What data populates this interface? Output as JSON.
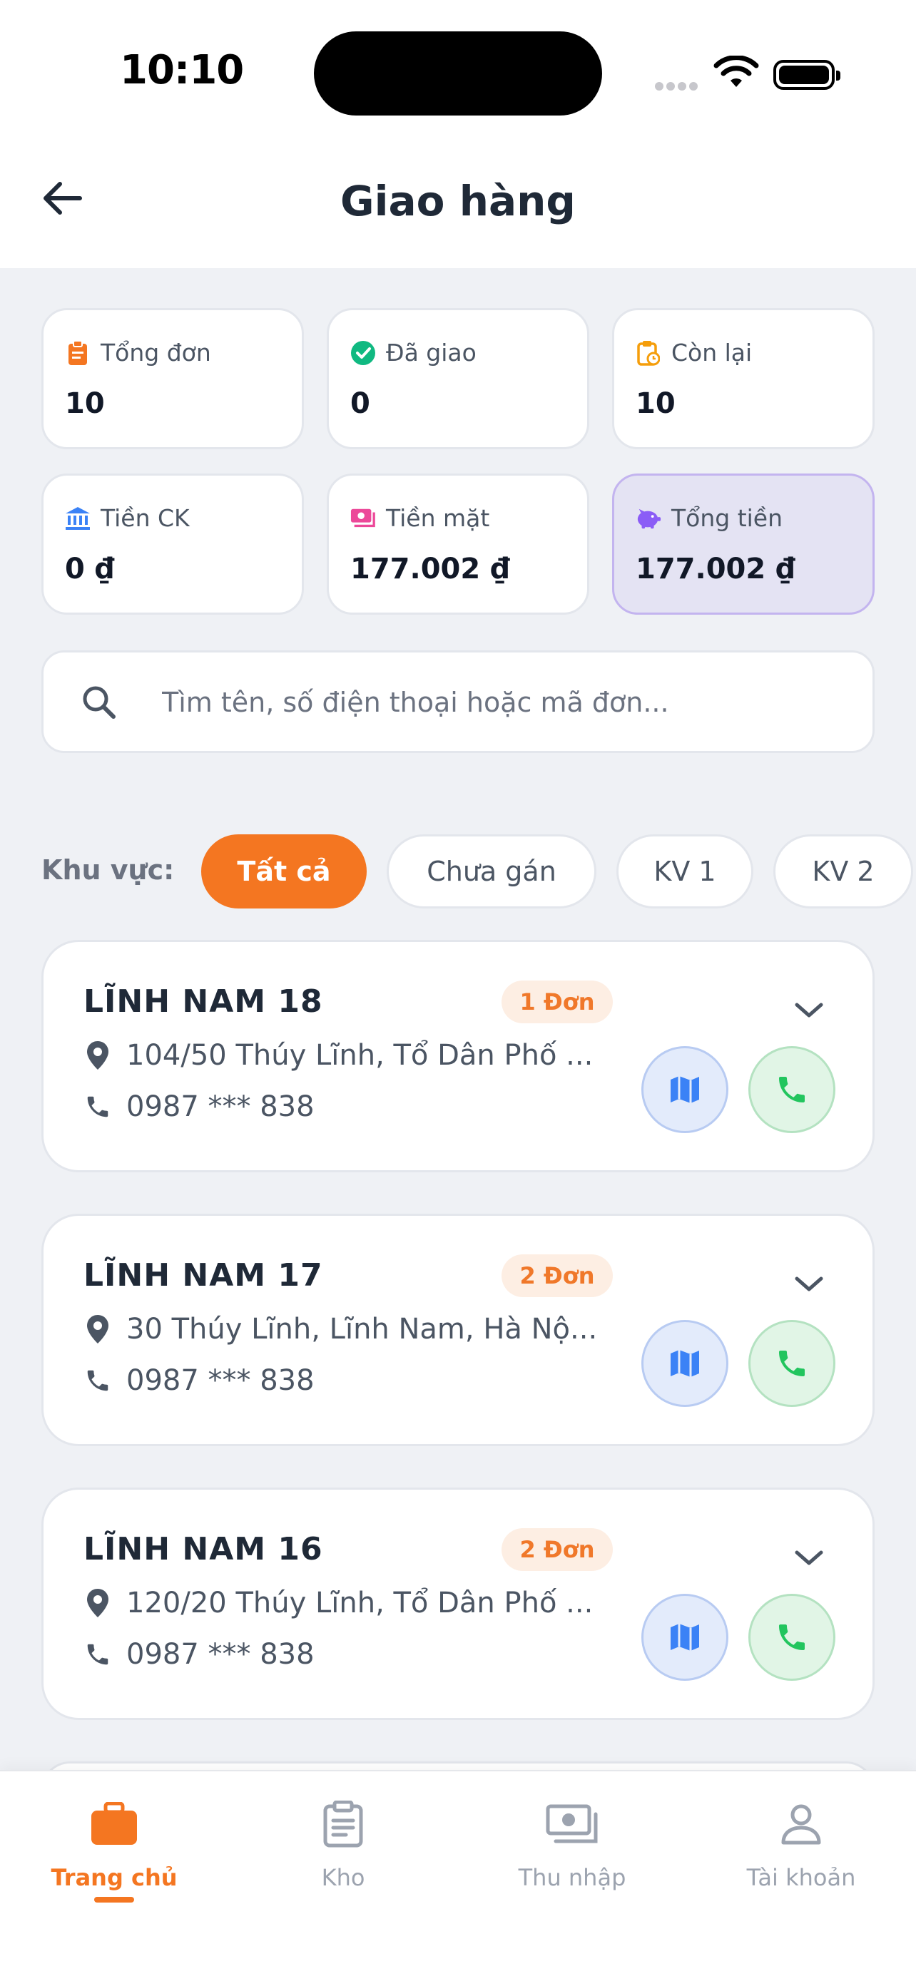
{
  "status_bar": {
    "time": "10:10"
  },
  "header": {
    "title": "Giao hàng"
  },
  "stats": [
    {
      "label": "Tổng đơn",
      "value": "10",
      "icon": "clipboard-icon",
      "color": "#f47621"
    },
    {
      "label": "Đã giao",
      "value": "0",
      "icon": "check-circle-icon",
      "color": "#10b981"
    },
    {
      "label": "Còn lại",
      "value": "10",
      "icon": "clipboard-clock-icon",
      "color": "#f59e0b"
    },
    {
      "label": "Tiền CK",
      "value": "0 ₫",
      "icon": "bank-icon",
      "color": "#3b82f6"
    },
    {
      "label": "Tiền mặt",
      "value": "177.002 ₫",
      "icon": "cash-icon",
      "color": "#ec4899"
    },
    {
      "label": "Tổng tiền",
      "value": "177.002 ₫",
      "icon": "piggy-bank-icon",
      "color": "#8b5cf6"
    }
  ],
  "search": {
    "placeholder": "Tìm tên, số điện thoại hoặc mã đơn..."
  },
  "area_filter": {
    "label": "Khu vực:",
    "chips": [
      "Tất cả",
      "Chưa gán",
      "KV 1",
      "KV 2"
    ],
    "active_index": 0
  },
  "deliveries": [
    {
      "name": "LĨNH NAM 18",
      "orders": "1 Đơn",
      "address": "104/50 Thúy Lĩnh, Tổ Dân Phố ...",
      "phone": "0987 *** 838"
    },
    {
      "name": "LĨNH NAM 17",
      "orders": "2 Đơn",
      "address": "30 Thúy Lĩnh, Lĩnh Nam, Hà Nộ...",
      "phone": "0987 *** 838"
    },
    {
      "name": "LĨNH NAM 16",
      "orders": "2 Đơn",
      "address": "120/20 Thúy Lĩnh, Tổ Dân Phố ...",
      "phone": "0987 *** 838"
    }
  ],
  "bottom_nav": [
    {
      "label": "Trang chủ",
      "icon": "briefcase-icon",
      "active": true
    },
    {
      "label": "Kho",
      "icon": "clipboard-list-icon",
      "active": false
    },
    {
      "label": "Thu nhập",
      "icon": "money-icon",
      "active": false
    },
    {
      "label": "Tài khoản",
      "icon": "user-icon",
      "active": false
    }
  ],
  "colors": {
    "accent": "#f47621",
    "background": "#eff1f5",
    "map_button": "#3b82f6",
    "call_button": "#22c55e"
  }
}
